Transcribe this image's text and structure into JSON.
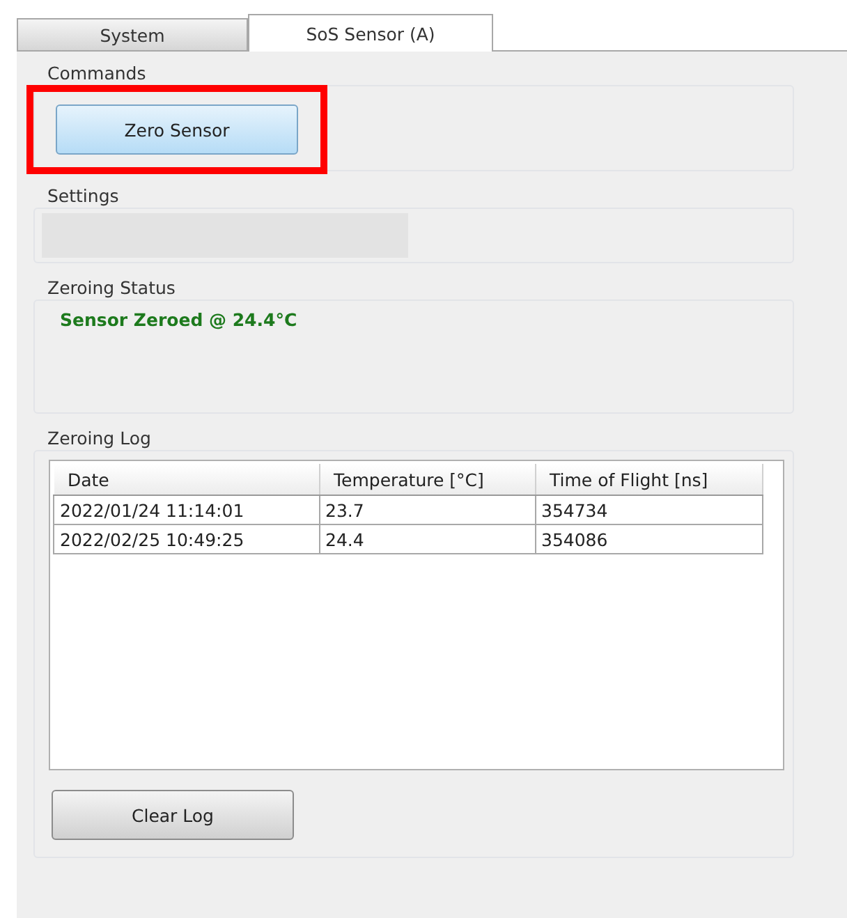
{
  "tabs": [
    {
      "label": "System",
      "selected": false
    },
    {
      "label": "SoS Sensor (A)",
      "selected": true
    }
  ],
  "commands": {
    "title": "Commands",
    "button": {
      "label": "Zero Sensor",
      "highlighted": true
    }
  },
  "settings": {
    "title": "Settings"
  },
  "zeroing_status": {
    "title": "Zeroing Status",
    "message": "Sensor Zeroed @ 24.4°C"
  },
  "zeroing_log": {
    "title": "Zeroing Log",
    "table": {
      "columns": [
        "Date",
        "Temperature [°C]",
        "Time of Flight [ns]"
      ],
      "rows": [
        [
          "2022/01/24 11:14:01",
          "23.7",
          "354734"
        ],
        [
          "2022/02/25 10:49:25",
          "24.4",
          "354086"
        ]
      ]
    },
    "button": {
      "label": "Clear Log"
    }
  }
}
